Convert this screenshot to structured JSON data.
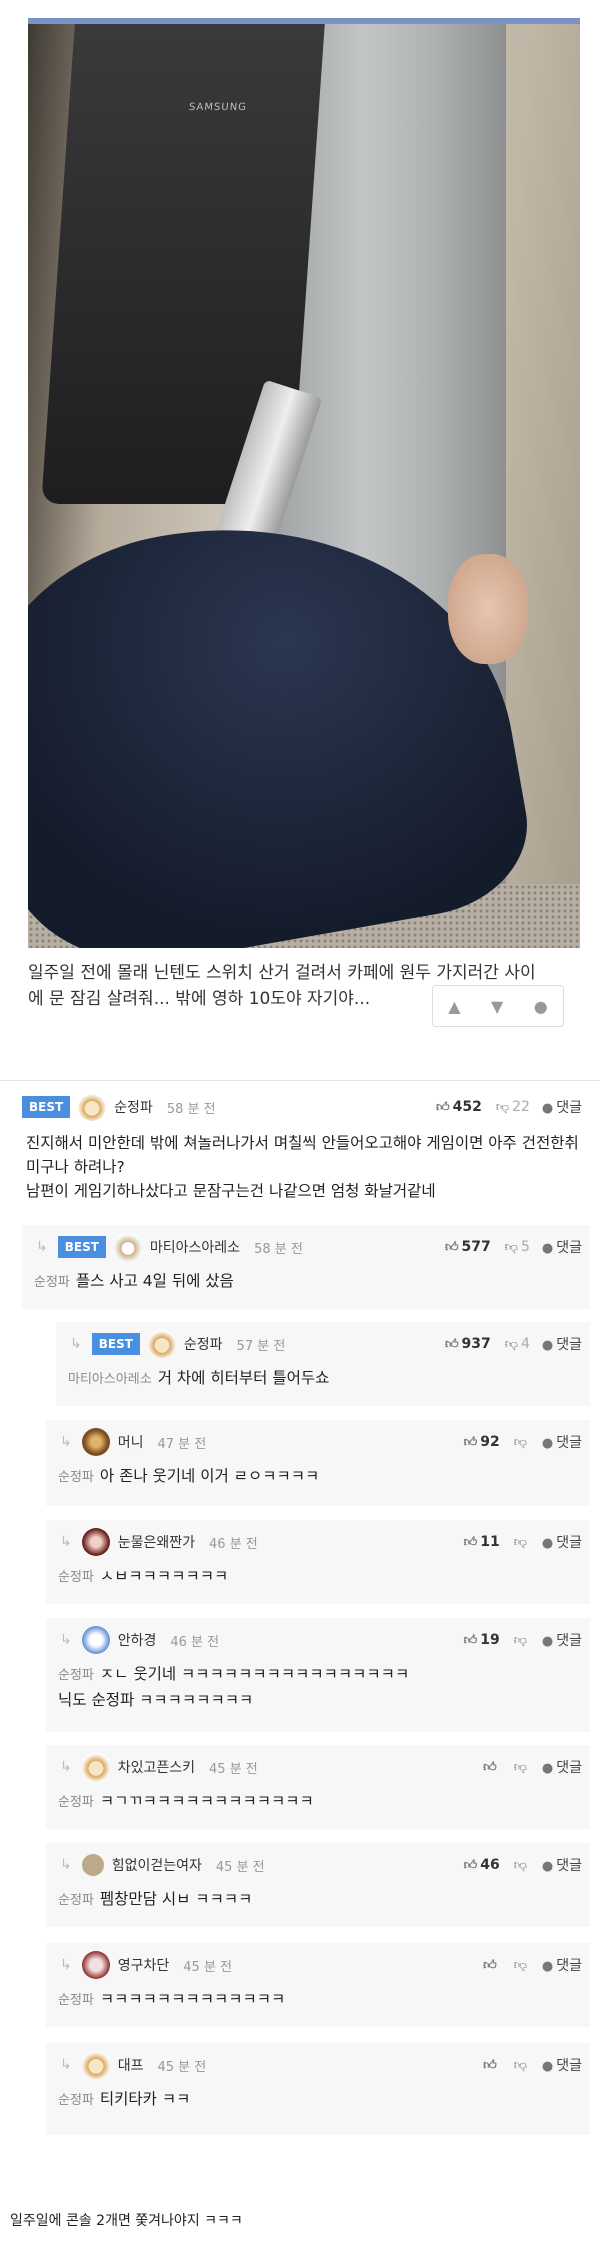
{
  "photo": {
    "brand": "SAMSUNG"
  },
  "post": {
    "caption": "일주일 전에 몰래 닌텐도 스위치 산거 걸려서  카페에 원두 가지러간 사이에 문 잠김 살려줘... 밖에 영하 10도야 자기야..."
  },
  "labels": {
    "best": "BEST",
    "reply": "댓글"
  },
  "comments": [
    {
      "nick": "순정파",
      "time": "58 분 전",
      "up": "452",
      "down": "22",
      "avatar": "dog",
      "mention": "",
      "text": [
        "진지해서 미안한데 밖에 쳐놀러나가서 며칠씩 안들어오고해야 게임이면 아주 건전한취미구나 하려나?",
        "남편이 게임기하나샀다고 문잠구는건 나같으면 엄청 화날거같네"
      ]
    },
    {
      "nick": "마티아스아레소",
      "time": "58 분 전",
      "up": "577",
      "down": "5",
      "avatar": "dog2",
      "mention": "순정파",
      "text": [
        "플스 사고 4일 뒤에 샀음"
      ]
    },
    {
      "nick": "순정파",
      "time": "57 분 전",
      "up": "937",
      "down": "4",
      "avatar": "dog",
      "mention": "마티아스아레소",
      "text": [
        "거 차에 히터부터 틀어두쇼"
      ]
    },
    {
      "nick": "머니",
      "time": "47 분 전",
      "up": "92",
      "down": "",
      "avatar": "lion",
      "mention": "순정파",
      "text": [
        "아 존나 웃기네 이거 ㄹㅇㅋㅋㅋㅋ"
      ]
    },
    {
      "nick": "눈물은왜짠가",
      "time": "46 분 전",
      "up": "11",
      "down": "",
      "avatar": "cat",
      "mention": "순정파",
      "text": [
        "ㅅㅂㅋㅋㅋㅋㅋㅋㅋ"
      ]
    },
    {
      "nick": "안하경",
      "time": "46 분 전",
      "up": "19",
      "down": "",
      "avatar": "ghost",
      "mention": "순정파",
      "text": [
        "ㅈㄴ 웃기네 ㅋㅋㅋㅋㅋㅋㅋㅋㅋㅋㅋㅋㅋㅋㅋㅋ",
        "닉도 순정파 ㅋㅋㅋㅋㅋㅋㅋㅋ"
      ]
    },
    {
      "nick": "차있고픈스키",
      "time": "45 분 전",
      "up": "",
      "down": "",
      "avatar": "dog",
      "mention": "순정파",
      "text": [
        "ㅋㄱㄲㅋㅋㅋㅋㅋㅋㅋㅋㅋㅋㅋㅋ"
      ]
    },
    {
      "nick": "힘없이걷는여자",
      "time": "45 분 전",
      "up": "46",
      "down": "",
      "avatar": "dot",
      "mention": "순정파",
      "text": [
        "펨창만담 시ㅂ ㅋㅋㅋㅋ"
      ]
    },
    {
      "nick": "영구차단",
      "time": "45 분 전",
      "up": "",
      "down": "",
      "avatar": "mon",
      "mention": "순정파",
      "text": [
        "ㅋㅋㅋㅋㅋㅋㅋㅋㅋㅋㅋㅋㅋ"
      ]
    },
    {
      "nick": "대프",
      "time": "45 분 전",
      "up": "",
      "down": "",
      "avatar": "dog",
      "mention": "순정파",
      "text": [
        "티키타카 ㅋㅋ"
      ]
    }
  ],
  "footer": "일주일에 콘솔 2개면 쫓겨나야지 ㅋㅋㅋ"
}
